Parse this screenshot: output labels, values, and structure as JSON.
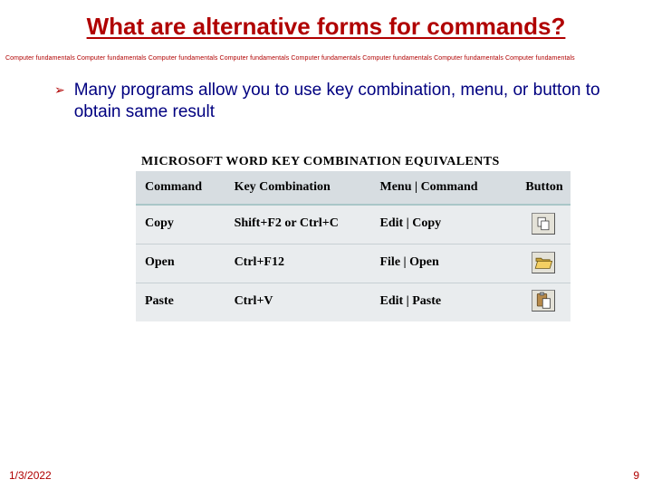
{
  "title": "What are alternative forms for commands?",
  "band_unit": "Computer fundamentals",
  "band_repeat": 8,
  "bullet": "Many programs allow you to use key combination, menu, or button to obtain same result",
  "table_title": "MICROSOFT WORD KEY COMBINATION EQUIVALENTS",
  "headers": {
    "command": "Command",
    "key": "Key Combination",
    "menu": "Menu | Command",
    "button": "Button"
  },
  "rows": [
    {
      "command": "Copy",
      "key": "Shift+F2 or Ctrl+C",
      "menu": "Edit | Copy",
      "icon": "copy-icon"
    },
    {
      "command": "Open",
      "key": "Ctrl+F12",
      "menu": "File | Open",
      "icon": "open-icon"
    },
    {
      "command": "Paste",
      "key": "Ctrl+V",
      "menu": "Edit | Paste",
      "icon": "paste-icon"
    }
  ],
  "footer": {
    "date": "1/3/2022",
    "page": "9"
  }
}
